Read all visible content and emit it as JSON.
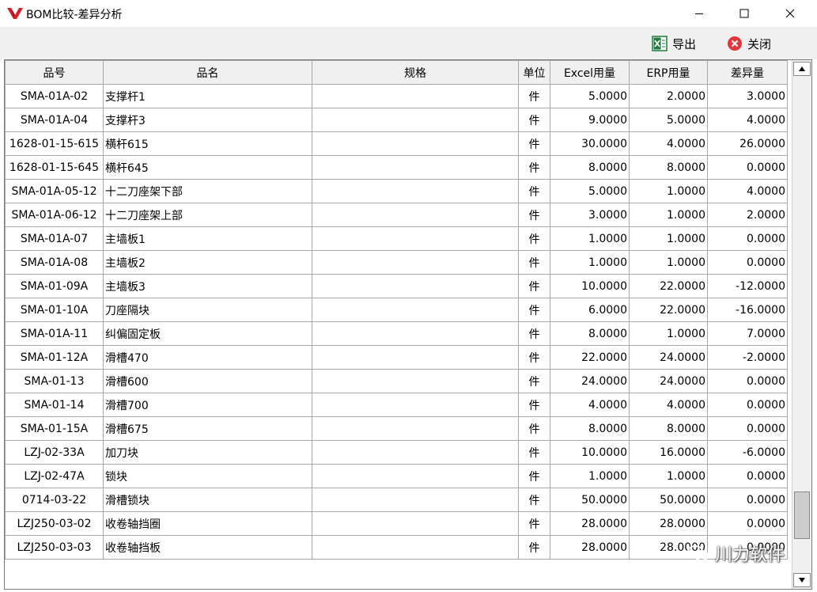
{
  "window": {
    "title": "BOM比较-差异分析"
  },
  "toolbar": {
    "export_label": "导出",
    "close_label": "关闭"
  },
  "table": {
    "columns": [
      "品号",
      "品名",
      "规格",
      "单位",
      "Excel用量",
      "ERP用量",
      "差异量"
    ],
    "rows": [
      {
        "code": "SMA-01A-02",
        "name": "支撑杆1",
        "spec": "",
        "unit": "件",
        "excel": "5.0000",
        "erp": "2.0000",
        "diff": "3.0000"
      },
      {
        "code": "SMA-01A-04",
        "name": "支撑杆3",
        "spec": "",
        "unit": "件",
        "excel": "9.0000",
        "erp": "5.0000",
        "diff": "4.0000"
      },
      {
        "code": "1628-01-15-615",
        "name": "横杆615",
        "spec": "",
        "unit": "件",
        "excel": "30.0000",
        "erp": "4.0000",
        "diff": "26.0000"
      },
      {
        "code": "1628-01-15-645",
        "name": "横杆645",
        "spec": "",
        "unit": "件",
        "excel": "8.0000",
        "erp": "8.0000",
        "diff": "0.0000"
      },
      {
        "code": "SMA-01A-05-12",
        "name": "十二刀座架下部",
        "spec": "",
        "unit": "件",
        "excel": "5.0000",
        "erp": "1.0000",
        "diff": "4.0000"
      },
      {
        "code": "SMA-01A-06-12",
        "name": "十二刀座架上部",
        "spec": "",
        "unit": "件",
        "excel": "3.0000",
        "erp": "1.0000",
        "diff": "2.0000"
      },
      {
        "code": "SMA-01A-07",
        "name": "主墙板1",
        "spec": "",
        "unit": "件",
        "excel": "1.0000",
        "erp": "1.0000",
        "diff": "0.0000"
      },
      {
        "code": "SMA-01A-08",
        "name": "主墙板2",
        "spec": "",
        "unit": "件",
        "excel": "1.0000",
        "erp": "1.0000",
        "diff": "0.0000"
      },
      {
        "code": "SMA-01-09A",
        "name": "主墙板3",
        "spec": "",
        "unit": "件",
        "excel": "10.0000",
        "erp": "22.0000",
        "diff": "-12.0000"
      },
      {
        "code": "SMA-01-10A",
        "name": "刀座隔块",
        "spec": "",
        "unit": "件",
        "excel": "6.0000",
        "erp": "22.0000",
        "diff": "-16.0000"
      },
      {
        "code": "SMA-01A-11",
        "name": "纠偏固定板",
        "spec": "",
        "unit": "件",
        "excel": "8.0000",
        "erp": "1.0000",
        "diff": "7.0000"
      },
      {
        "code": "SMA-01-12A",
        "name": "滑槽470",
        "spec": "",
        "unit": "件",
        "excel": "22.0000",
        "erp": "24.0000",
        "diff": "-2.0000"
      },
      {
        "code": "SMA-01-13",
        "name": "滑槽600",
        "spec": "",
        "unit": "件",
        "excel": "24.0000",
        "erp": "24.0000",
        "diff": "0.0000"
      },
      {
        "code": "SMA-01-14",
        "name": "滑槽700",
        "spec": "",
        "unit": "件",
        "excel": "4.0000",
        "erp": "4.0000",
        "diff": "0.0000"
      },
      {
        "code": "SMA-01-15A",
        "name": "滑槽675",
        "spec": "",
        "unit": "件",
        "excel": "8.0000",
        "erp": "8.0000",
        "diff": "0.0000"
      },
      {
        "code": "LZJ-02-33A",
        "name": "加刀块",
        "spec": "",
        "unit": "件",
        "excel": "10.0000",
        "erp": "16.0000",
        "diff": "-6.0000"
      },
      {
        "code": "LZJ-02-47A",
        "name": "锁块",
        "spec": "",
        "unit": "件",
        "excel": "1.0000",
        "erp": "1.0000",
        "diff": "0.0000"
      },
      {
        "code": "0714-03-22",
        "name": "滑槽锁块",
        "spec": "",
        "unit": "件",
        "excel": "50.0000",
        "erp": "50.0000",
        "diff": "0.0000"
      },
      {
        "code": "LZJ250-03-02",
        "name": "收卷轴挡圈",
        "spec": "",
        "unit": "件",
        "excel": "28.0000",
        "erp": "28.0000",
        "diff": "0.0000"
      },
      {
        "code": "LZJ250-03-03",
        "name": "收卷轴挡板",
        "spec": "",
        "unit": "件",
        "excel": "28.0000",
        "erp": "28.0000",
        "diff": "0.0000"
      }
    ]
  },
  "watermark": {
    "text": "川力软件"
  },
  "colors": {
    "excel_icon": "#1e7a3c",
    "close_icon": "#e0383e",
    "brand_logo": "#d8202a"
  }
}
